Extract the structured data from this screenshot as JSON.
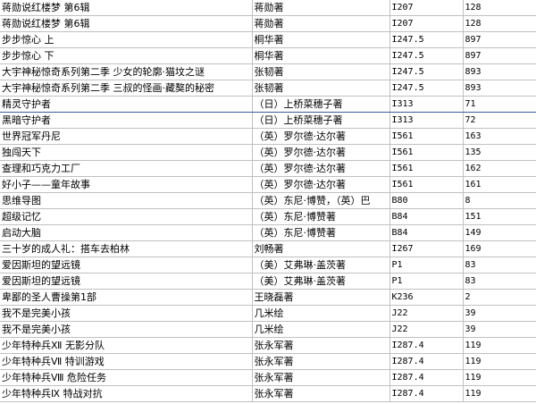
{
  "rows": [
    {
      "title": "蒋勋说红楼梦 第6辑",
      "author": "蒋勋著",
      "call_no": "I207",
      "num": "128"
    },
    {
      "title": "蒋勋说红楼梦 第6辑",
      "author": "蒋勋著",
      "call_no": "I207",
      "num": "128"
    },
    {
      "title": "步步惊心 上",
      "author": "桐华著",
      "call_no": "I247.5",
      "num": "897"
    },
    {
      "title": "步步惊心 下",
      "author": "桐华著",
      "call_no": "I247.5",
      "num": "897"
    },
    {
      "title": "大宇神秘惊奇系列第二季 少女的轮廓·猫坟之谜",
      "author": "张韧著",
      "call_no": "I247.5",
      "num": "893"
    },
    {
      "title": "大宇神秘惊奇系列第二季 三叔的怪画·藏獒的秘密",
      "author": "张韧著",
      "call_no": "I247.5",
      "num": "893"
    },
    {
      "title": "精灵守护者",
      "author": "（日）上桥菜穗子著",
      "call_no": "I313",
      "num": "71"
    },
    {
      "title": "黑暗守护者",
      "author": "（日）上桥菜穗子著",
      "call_no": "I313",
      "num": "72"
    },
    {
      "title": "世界冠军丹尼",
      "author": "（英）罗尔德·达尔著",
      "call_no": "I561",
      "num": "163"
    },
    {
      "title": "独闯天下",
      "author": "（英）罗尔德·达尔著",
      "call_no": "I561",
      "num": "135"
    },
    {
      "title": "查理和巧克力工厂",
      "author": "（英）罗尔德·达尔著",
      "call_no": "I561",
      "num": "162"
    },
    {
      "title": "好小子——童年故事",
      "author": "（英）罗尔德·达尔著",
      "call_no": "I561",
      "num": "161"
    },
    {
      "title": "思维导图",
      "author": "（英）东尼·博赞，（英）巴",
      "call_no": "B80",
      "num": "8"
    },
    {
      "title": "超级记忆",
      "author": "（英）东尼·博赞著",
      "call_no": "B84",
      "num": "151"
    },
    {
      "title": "启动大脑",
      "author": "（英）东尼·博赞著",
      "call_no": "B84",
      "num": "149"
    },
    {
      "title": "三十岁的成人礼：搭车去柏林",
      "author": "刘畅著",
      "call_no": "I267",
      "num": "169"
    },
    {
      "title": "爱因斯坦的望远镜",
      "author": "（美）艾弗琳·盖茨著",
      "call_no": "P1",
      "num": "83"
    },
    {
      "title": "爱因斯坦的望远镜",
      "author": "（美）艾弗琳·盖茨著",
      "call_no": "P1",
      "num": "83"
    },
    {
      "title": "卑鄙的圣人曹操第1部",
      "author": "王晓磊著",
      "call_no": "K236",
      "num": "2"
    },
    {
      "title": "我不是完美小孩",
      "author": "几米绘",
      "call_no": "J22",
      "num": "39"
    },
    {
      "title": "我不是完美小孩",
      "author": "几米绘",
      "call_no": "J22",
      "num": "39"
    },
    {
      "title": "少年特种兵Ⅻ 无影分队",
      "author": "张永军著",
      "call_no": "I287.4",
      "num": "119"
    },
    {
      "title": "少年特种兵Ⅶ 特训游戏",
      "author": "张永军著",
      "call_no": "I287.4",
      "num": "119"
    },
    {
      "title": "少年特种兵Ⅷ 危险任务",
      "author": "张永军著",
      "call_no": "I287.4",
      "num": "119"
    },
    {
      "title": "少年特种兵Ⅸ 特战对抗",
      "author": "张永军著",
      "call_no": "I287.4",
      "num": "119"
    }
  ]
}
